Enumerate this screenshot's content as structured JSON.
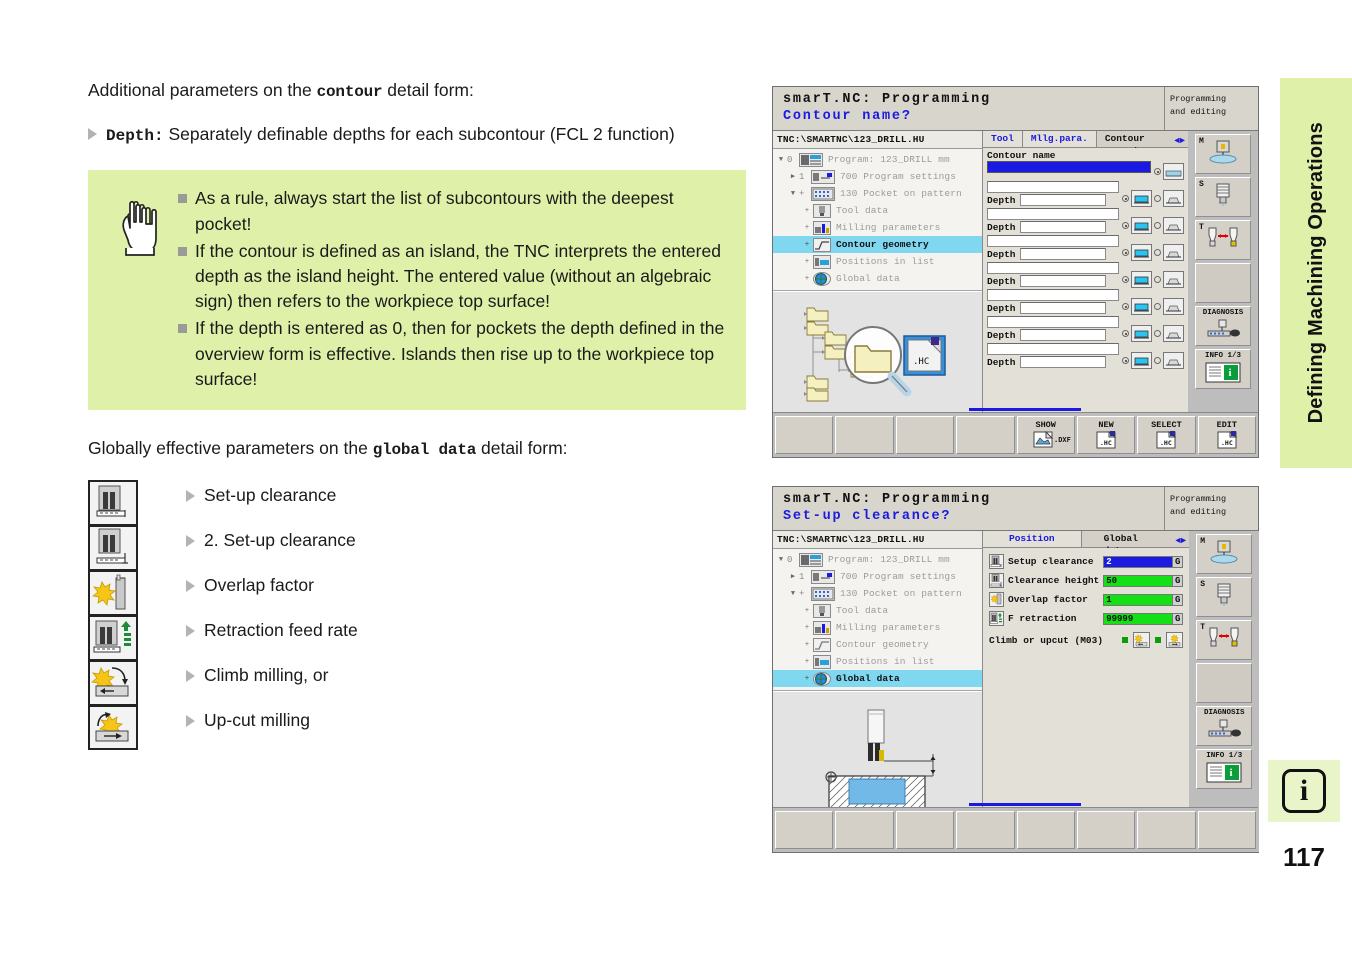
{
  "doc": {
    "intro": {
      "pre": "Additional parameters on the ",
      "mono": "contour",
      "post": " detail form:"
    },
    "depth_bullet": {
      "term": "Depth:",
      "text": " Separately definable depths for each subcontour (FCL 2 function)"
    },
    "note_items": [
      "As a rule, always start the list of subcontours with the deepest pocket!",
      "If the contour is defined as an island, the TNC interprets the entered depth as the island height. The entered value (without an algebraic sign) then refers to the workpiece top surface!",
      "If the depth is entered as 0, then for pockets the depth defined in the overview form is effective. Islands then rise up to the workpiece top surface!"
    ],
    "global_intro": {
      "pre": "Globally effective parameters on the ",
      "mono": "global data",
      "post": " detail form:"
    },
    "global_items": [
      {
        "label": "Set-up clearance",
        "icon": "setup-clearance-icon"
      },
      {
        "label": "2. Set-up clearance",
        "icon": "second-setup-clearance-icon"
      },
      {
        "label": "Overlap factor",
        "icon": "overlap-factor-icon"
      },
      {
        "label": "Retraction feed rate",
        "icon": "retraction-feed-rate-icon"
      },
      {
        "label": "Climb milling, or",
        "icon": "climb-milling-icon"
      },
      {
        "label": "Up-cut milling",
        "icon": "upcut-milling-icon"
      }
    ],
    "side_tab": "Defining Machining Operations",
    "info_glyph": "i",
    "page_number": "117"
  },
  "screen1": {
    "title_line1": "smarT.NC: Programming",
    "title_line2": "Contour name?",
    "mode_line1": "Programming",
    "mode_line2": "and editing",
    "path": "TNC:\\SMARTNC\\123_DRILL.HU",
    "tree": [
      {
        "arrow": "▼",
        "num": "0",
        "indent": 0,
        "label": "Program: 123_DRILL mm",
        "icon": "program-icon",
        "selected": false
      },
      {
        "arrow": "▶",
        "num": "1",
        "indent": 1,
        "label": "700 Program settings",
        "icon": "settings-icon",
        "selected": false
      },
      {
        "arrow": "▼",
        "num": "+",
        "indent": 1,
        "label": "130 Pocket on pattern",
        "icon": "pattern-icon",
        "selected": false
      },
      {
        "arrow": "+",
        "num": "",
        "indent": 2,
        "label": "Tool data",
        "icon": "tool-data-icon",
        "selected": false
      },
      {
        "arrow": "+",
        "num": "",
        "indent": 2,
        "label": "Milling parameters",
        "icon": "milling-param-icon",
        "selected": false
      },
      {
        "arrow": "+",
        "num": "",
        "indent": 2,
        "label": "Contour geometry",
        "icon": "contour-geom-icon",
        "selected": true
      },
      {
        "arrow": "+",
        "num": "",
        "indent": 2,
        "label": "Positions in list",
        "icon": "positions-icon",
        "selected": false
      },
      {
        "arrow": "+",
        "num": "",
        "indent": 2,
        "label": "Global data",
        "icon": "global-data-icon",
        "selected": false
      }
    ],
    "tabs": [
      {
        "label": "Tool",
        "state": "active"
      },
      {
        "label": "Mllg.para.",
        "state": "active"
      },
      {
        "label": "Contour geometry",
        "state": "inactive"
      }
    ],
    "tab_arrows": "◄►",
    "form": {
      "contour_name_label": "Contour name",
      "depth_label": "Depth",
      "rows": 8
    },
    "softkeys": [
      {
        "label": "",
        "sub": "",
        "icon": ""
      },
      {
        "label": "",
        "sub": "",
        "icon": ""
      },
      {
        "label": "",
        "sub": "",
        "icon": ""
      },
      {
        "label": "",
        "sub": "",
        "icon": ""
      },
      {
        "label": "SHOW",
        "sub": ".DXF",
        "icon": "dxf-preview-icon"
      },
      {
        "label": "NEW",
        "sub": ".HC",
        "icon": "new-hc-icon"
      },
      {
        "label": "SELECT",
        "sub": ".HC",
        "icon": "select-hc-icon"
      },
      {
        "label": "EDIT",
        "sub": ".HC",
        "icon": "edit-hc-icon"
      }
    ],
    "vkeys": [
      {
        "label": "M",
        "icon": "machine-icon"
      },
      {
        "label": "S",
        "icon": "spindle-icon"
      },
      {
        "label": "T",
        "icon": "tool-change-icon"
      },
      {
        "label": "",
        "icon": ""
      },
      {
        "label": "DIAGNOSIS",
        "icon": "diagnosis-icon",
        "centered": true
      },
      {
        "label": "INFO 1/3",
        "icon": "info-icon",
        "centered": true
      }
    ],
    "graphic": "folder-tree-magnifier-hc-file"
  },
  "screen2": {
    "title_line1": "smarT.NC: Programming",
    "title_line2": "Set-up clearance?",
    "mode_line1": "Programming",
    "mode_line2": "and editing",
    "path": "TNC:\\SMARTNC\\123_DRILL.HU",
    "tree": [
      {
        "arrow": "▼",
        "num": "0",
        "indent": 0,
        "label": "Program: 123_DRILL mm",
        "icon": "program-icon",
        "selected": false
      },
      {
        "arrow": "▶",
        "num": "1",
        "indent": 1,
        "label": "700 Program settings",
        "icon": "settings-icon",
        "selected": false
      },
      {
        "arrow": "▼",
        "num": "+",
        "indent": 1,
        "label": "130 Pocket on pattern",
        "icon": "pattern-icon",
        "selected": false
      },
      {
        "arrow": "+",
        "num": "",
        "indent": 2,
        "label": "Tool data",
        "icon": "tool-data-icon",
        "selected": false
      },
      {
        "arrow": "+",
        "num": "",
        "indent": 2,
        "label": "Milling parameters",
        "icon": "milling-param-icon",
        "selected": false
      },
      {
        "arrow": "+",
        "num": "",
        "indent": 2,
        "label": "Contour geometry",
        "icon": "contour-geom-icon",
        "selected": false
      },
      {
        "arrow": "+",
        "num": "",
        "indent": 2,
        "label": "Positions in list",
        "icon": "positions-icon",
        "selected": false
      },
      {
        "arrow": "+",
        "num": "",
        "indent": 2,
        "label": "Global data",
        "icon": "global-data-icon",
        "selected": true
      }
    ],
    "tabs": [
      {
        "label": "Position",
        "state": "active"
      },
      {
        "label": "Global data",
        "state": "inactive"
      }
    ],
    "tab_arrows": "◄►",
    "fields": [
      {
        "label": "Setup clearance",
        "value": "2",
        "unit": "G",
        "state": "selected",
        "icon": "setup-clearance-icon"
      },
      {
        "label": "Clearance height",
        "value": "50",
        "unit": "G",
        "state": "green",
        "icon": "clearance-height-icon"
      },
      {
        "label": "Overlap factor",
        "value": "1",
        "unit": "G",
        "state": "green",
        "icon": "overlap-factor-icon"
      },
      {
        "label": "F retraction",
        "value": "99999",
        "unit": "G",
        "state": "green",
        "icon": "retraction-feed-icon"
      }
    ],
    "climb_label": "Climb or upcut (M03)",
    "climb_options": [
      "climb-milling-icon",
      "upcut-milling-icon"
    ],
    "softkeys": [
      {
        "label": "",
        "sub": "",
        "icon": ""
      },
      {
        "label": "",
        "sub": "",
        "icon": ""
      },
      {
        "label": "",
        "sub": "",
        "icon": ""
      },
      {
        "label": "",
        "sub": "",
        "icon": ""
      },
      {
        "label": "",
        "sub": "",
        "icon": ""
      },
      {
        "label": "",
        "sub": "",
        "icon": ""
      },
      {
        "label": "",
        "sub": "",
        "icon": ""
      },
      {
        "label": "",
        "sub": "",
        "icon": ""
      }
    ],
    "vkeys": [
      {
        "label": "M",
        "icon": "machine-icon"
      },
      {
        "label": "S",
        "icon": "spindle-icon"
      },
      {
        "label": "T",
        "icon": "tool-change-icon"
      },
      {
        "label": "",
        "icon": ""
      },
      {
        "label": "DIAGNOSIS",
        "icon": "diagnosis-icon",
        "centered": true
      },
      {
        "label": "INFO 1/3",
        "icon": "info-icon",
        "centered": true
      }
    ],
    "graphic": "endmill-over-pocket-with-clearance-dimension"
  }
}
